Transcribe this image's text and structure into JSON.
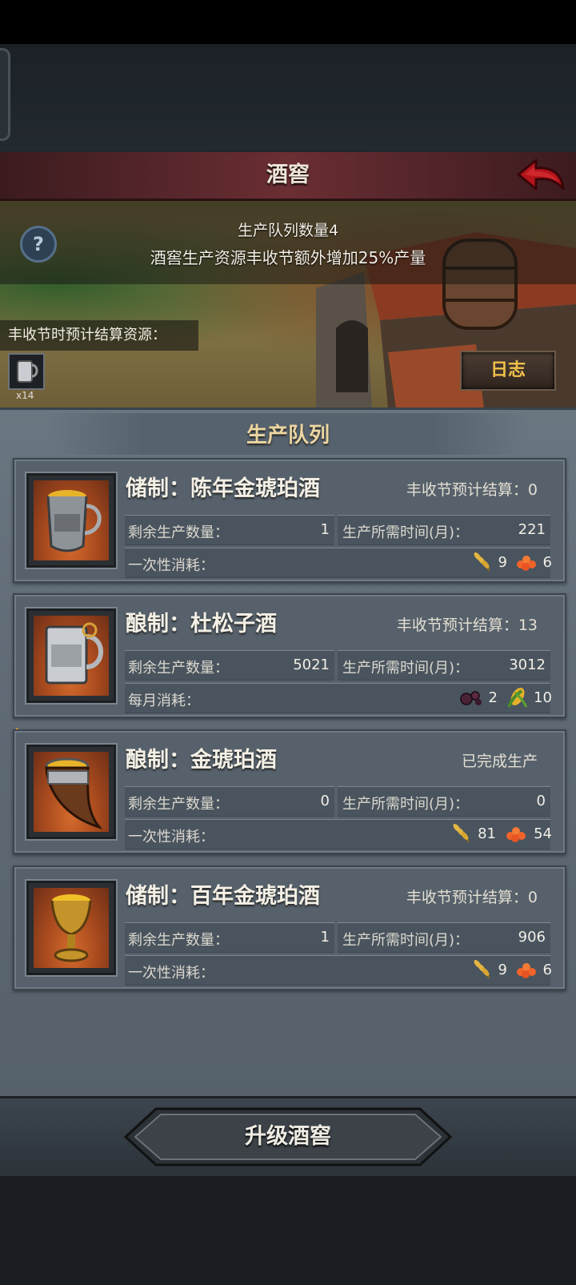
{
  "header": {
    "title": "酒窖"
  },
  "banner": {
    "queue_count": "生产队列数量4",
    "bonus": "酒窖生产资源丰收节额外增加25%产量",
    "harvest_label": "丰收节时预计结算资源：",
    "resource_count": "x14",
    "log_button": "日志"
  },
  "queue": {
    "title": "生产队列",
    "items": [
      {
        "title": "储制：陈年金琥珀酒",
        "status": "丰收节预计结算：0",
        "remaining_label": "剩余生产数量：",
        "remaining": "1",
        "time_label": "生产所需时间(月)：",
        "time": "221",
        "cost_label": "一次性消耗：",
        "cost_a": "9",
        "cost_b": "6",
        "state": "none"
      },
      {
        "title": "酿制：杜松子酒",
        "status": "丰收节预计结算：13",
        "remaining_label": "剩余生产数量：",
        "remaining": "5021",
        "time_label": "生产所需时间(月)：",
        "time": "3012",
        "cost_label": "每月消耗：",
        "cost_a": "2",
        "cost_b": "10",
        "state": "paused"
      },
      {
        "title": "酿制：金琥珀酒",
        "status": "已完成生产",
        "remaining_label": "剩余生产数量：",
        "remaining": "0",
        "time_label": "生产所需时间(月)：",
        "time": "0",
        "cost_label": "一次性消耗：",
        "cost_a": "81",
        "cost_b": "54",
        "state": "playing"
      },
      {
        "title": "储制：百年金琥珀酒",
        "status": "丰收节预计结算：0",
        "remaining_label": "剩余生产数量：",
        "remaining": "1",
        "time_label": "生产所需时间(月)：",
        "time": "906",
        "cost_label": "一次性消耗：",
        "cost_a": "9",
        "cost_b": "6",
        "state": "none"
      }
    ]
  },
  "footer": {
    "upgrade_button": "升级酒窖"
  },
  "icons": {
    "back": "back-arrow-icon",
    "help": "question-icon",
    "pause": "pause-icon",
    "play": "play-icon",
    "wheat": "wheat-icon",
    "berries": "berries-icon",
    "corn": "corn-icon",
    "roe": "roe-icon"
  },
  "colors": {
    "header_red": "#6a2e33",
    "accent_gold": "#f0c04a",
    "queue_title": "#ecd6a1",
    "panel": "#5d6873"
  }
}
